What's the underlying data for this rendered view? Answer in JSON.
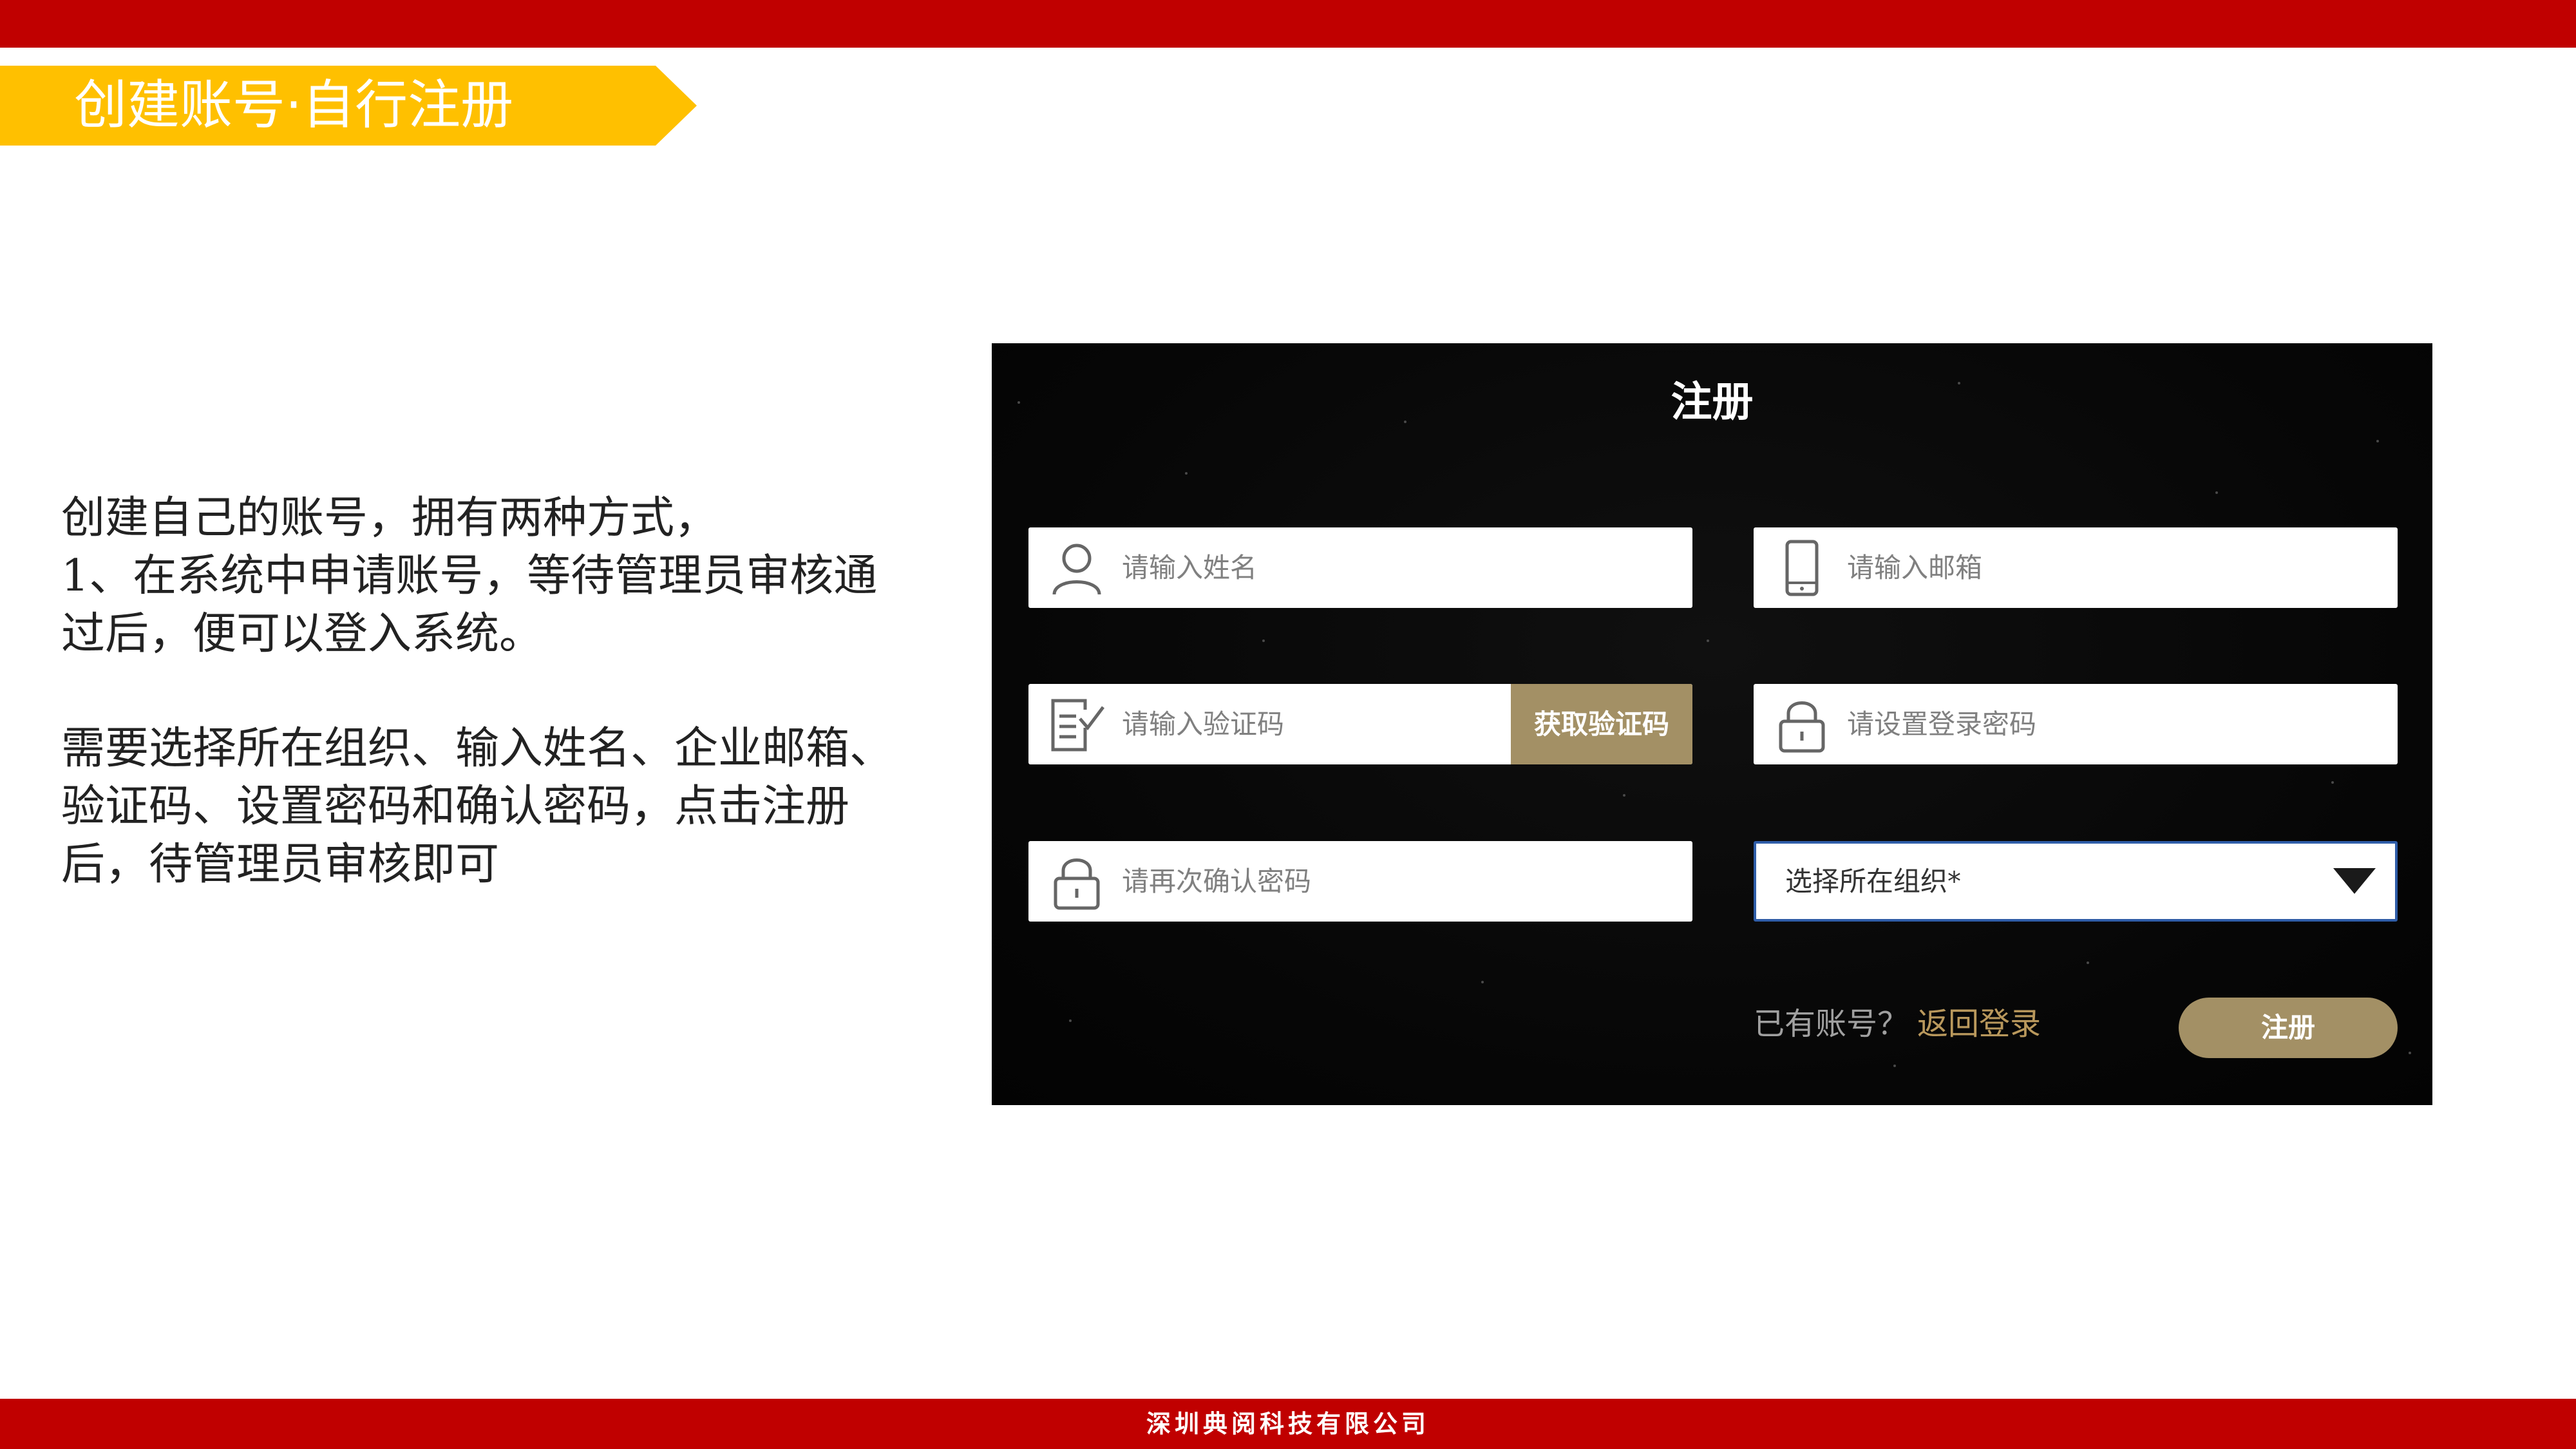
{
  "header": {
    "title": "创建账号·自行注册"
  },
  "description": {
    "paragraph1": "创建自己的账号，拥有两种方式，\n1、在系统中申请账号，等待管理员审核通过后，便可以登入系统。",
    "paragraph2": "需要选择所在组织、输入姓名、企业邮箱、验证码、设置密码和确认密码，点击注册后，待管理员审核即可"
  },
  "form": {
    "title": "注册",
    "name_placeholder": "请输入姓名",
    "email_placeholder": "请输入邮箱",
    "code_placeholder": "请输入验证码",
    "get_code_label": "获取验证码",
    "password_placeholder": "请设置登录密码",
    "confirm_placeholder": "请再次确认密码",
    "org_selected": "选择所在组织*",
    "have_account": "已有账号？",
    "back_to_login": "返回登录",
    "submit_label": "注册",
    "icons": {
      "name": "user-icon",
      "email": "phone-icon",
      "code": "verify-code-icon",
      "password": "lock-icon",
      "confirm": "lock-icon",
      "org": "caret-down-icon"
    }
  },
  "footer": {
    "company": "深圳典阅科技有限公司"
  },
  "colors": {
    "top_bar": "#c00000",
    "title_banner": "#ffc000",
    "accent_gold": "#a39065",
    "link_gold": "#b9985c",
    "panel_bg": "#060606"
  }
}
